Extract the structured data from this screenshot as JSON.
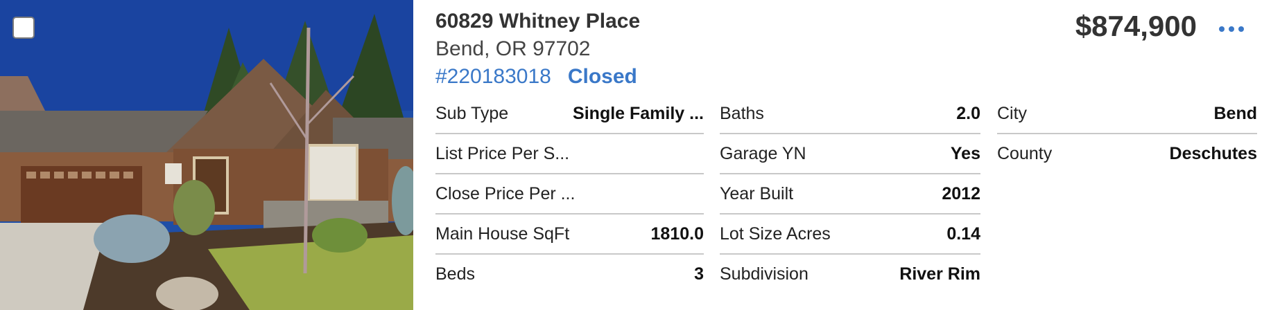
{
  "listing": {
    "address": "60829 Whitney Place",
    "city_state_zip": "Bend, OR 97702",
    "mls_number": "#220183018",
    "status": "Closed",
    "price": "$874,900",
    "more_icon": "ellipsis-horizontal-icon",
    "accent_color": "#3a78c8"
  },
  "details": {
    "col1": [
      {
        "label": "Sub Type",
        "value": "Single Family ..."
      },
      {
        "label": "List Price Per S...",
        "value": ""
      },
      {
        "label": "Close Price Per ...",
        "value": ""
      },
      {
        "label": "Main House SqFt",
        "value": "1810.0"
      },
      {
        "label": "Beds",
        "value": "3"
      }
    ],
    "col2": [
      {
        "label": "Baths",
        "value": "2.0"
      },
      {
        "label": "Garage YN",
        "value": "Yes"
      },
      {
        "label": "Year Built",
        "value": "2012"
      },
      {
        "label": "Lot Size Acres",
        "value": "0.14"
      },
      {
        "label": "Subdivision",
        "value": "River Rim"
      }
    ],
    "col3": [
      {
        "label": "City",
        "value": "Bend"
      },
      {
        "label": "County",
        "value": "Deschutes"
      }
    ]
  }
}
